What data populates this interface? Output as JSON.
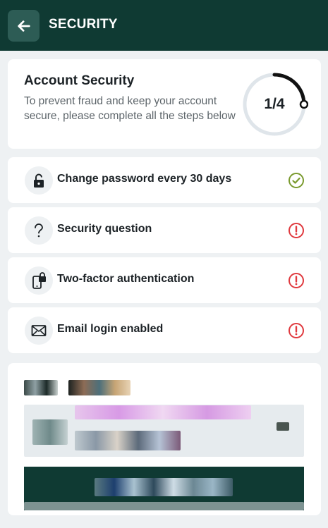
{
  "header": {
    "title": "SECURITY",
    "back_icon": "arrow-left-icon"
  },
  "summary": {
    "title": "Account Security",
    "description": "To prevent fraud and keep your account secure, please complete all the steps below",
    "progress_text": "1/4",
    "progress_fraction": 0.25
  },
  "steps": [
    {
      "label": "Change password every 30 days",
      "icon": "lock-icon",
      "status": "complete"
    },
    {
      "label": "Security question",
      "icon": "question-icon",
      "status": "incomplete"
    },
    {
      "label": "Two-factor authentication",
      "icon": "phone-lock-icon",
      "status": "incomplete"
    },
    {
      "label": "Email login enabled",
      "icon": "envelope-icon",
      "status": "incomplete"
    }
  ],
  "colors": {
    "header_bg": "#0f3a33",
    "complete": "#7a9a2e",
    "incomplete": "#e0393e",
    "ring_track": "#dfe5ea",
    "ring_progress": "#111111"
  }
}
